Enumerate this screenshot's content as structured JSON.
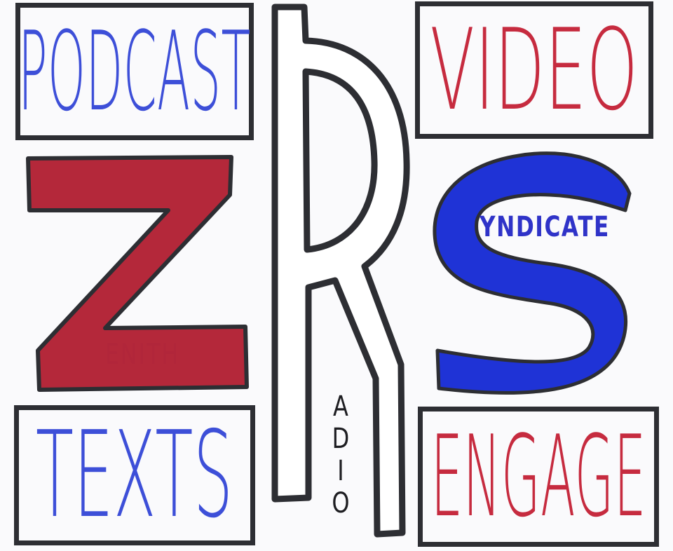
{
  "boxes": {
    "podcast": "PODCAST",
    "video": "VIDEO",
    "texts": "TEXTS",
    "engage": "ENGAGE"
  },
  "letters": {
    "z_rest": "ENITH",
    "s_rest": "YNDICATE",
    "r_rest": [
      "A",
      "D",
      "I",
      "O"
    ]
  },
  "colors": {
    "blue": "#3d4fd8",
    "red": "#c62b3f",
    "big_red": "#b4283a",
    "big_blue": "#1f33d6",
    "ink": "#2d2e33"
  }
}
